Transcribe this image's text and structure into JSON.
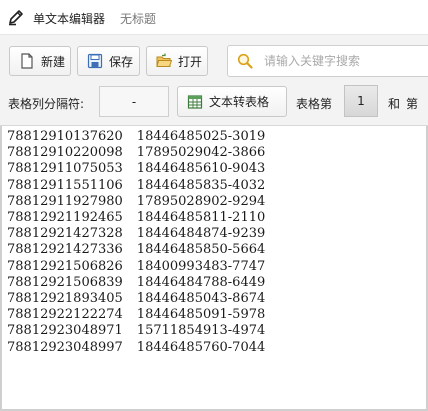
{
  "titlebar": {
    "app_icon": "pencil-edit-icon",
    "app_title": "单文本编辑器",
    "doc_title": "无标题"
  },
  "toolbar": {
    "new_label": "新建",
    "new_icon": "document-icon",
    "save_label": "保存",
    "save_icon": "save-icon",
    "open_label": "打开",
    "open_icon": "folder-open-icon",
    "search_placeholder": "请输入关键字搜索",
    "search_icon": "magnifier-icon"
  },
  "table_options": {
    "separator_label": "表格列分隔符:",
    "separator_value": "-",
    "convert_label": "文本转表格",
    "convert_icon": "table-convert-icon",
    "table_prefix_label": "表格第",
    "table_index": "1",
    "and_label": "和",
    "di_label": "第"
  },
  "editor": {
    "lines": [
      {
        "id": "78812910137620",
        "phone": "18446485025-3019"
      },
      {
        "id": "78812910220098",
        "phone": "17895029042-3866"
      },
      {
        "id": "78812911075053",
        "phone": "18446485610-9043"
      },
      {
        "id": "78812911551106",
        "phone": "18446485835-4032"
      },
      {
        "id": "78812911927980",
        "phone": "17895028902-9294"
      },
      {
        "id": "78812921192465",
        "phone": "18446485811-2110"
      },
      {
        "id": "78812921427328",
        "phone": "18446484874-9239"
      },
      {
        "id": "78812921427336",
        "phone": "18446485850-5664"
      },
      {
        "id": "78812921506826",
        "phone": "18400993483-7747"
      },
      {
        "id": "78812921506839",
        "phone": "18446484788-6449"
      },
      {
        "id": "78812921893405",
        "phone": "18446485043-8674"
      },
      {
        "id": "78812922122274",
        "phone": "18446485091-5978"
      },
      {
        "id": "78812923048971",
        "phone": "15711854913-4974"
      },
      {
        "id": "78812923048997",
        "phone": "18446485760-7044"
      }
    ]
  },
  "colors": {
    "toolbar_bg": "#f3f3f3",
    "border": "#cfcfcf",
    "text": "#222222",
    "placeholder": "#a9a9a9"
  }
}
